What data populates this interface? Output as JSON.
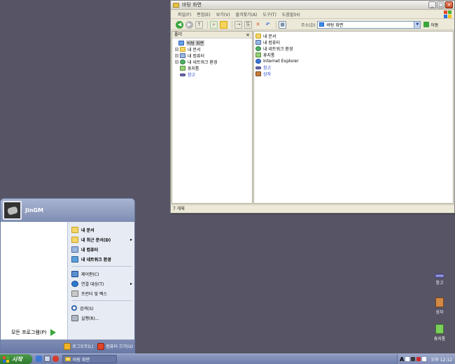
{
  "window": {
    "title": "바탕 화면",
    "menu": [
      "파일(F)",
      "편집(E)",
      "보기(V)",
      "즐겨찾기(A)",
      "도구(T)",
      "도움말(H)"
    ],
    "address_label": "주소(D)",
    "address_value": "바탕 화면",
    "go_label": "이동",
    "folders_title": "폴더",
    "tree": [
      {
        "label": "바탕 화면",
        "icon": "desktop-icon",
        "indent": 0,
        "expander": "",
        "selected": true
      },
      {
        "label": "내 문서",
        "icon": "folder-icon",
        "indent": 1,
        "expander": "+"
      },
      {
        "label": "내 컴퓨터",
        "icon": "computer-icon",
        "indent": 1,
        "expander": "+"
      },
      {
        "label": "내 네트워크 환경",
        "icon": "network-icon",
        "indent": 1,
        "expander": "+"
      },
      {
        "label": "휴지통",
        "icon": "recycle-bin-icon",
        "indent": 1,
        "expander": ""
      },
      {
        "label": "창고",
        "icon": "drive-icon",
        "indent": 1,
        "expander": "",
        "blue": true
      }
    ],
    "items": [
      {
        "label": "내 문서",
        "icon": "folder-icon"
      },
      {
        "label": "내 컴퓨터",
        "icon": "computer-icon"
      },
      {
        "label": "내 네트워크 환경",
        "icon": "network-icon"
      },
      {
        "label": "휴지통",
        "icon": "recycle-bin-icon"
      },
      {
        "label": "Internet Explorer",
        "icon": "internet-explorer-icon"
      },
      {
        "label": "창고",
        "icon": "drive-icon",
        "blue": true
      },
      {
        "label": "상자",
        "icon": "box-icon",
        "blue": true
      }
    ],
    "status": "7 개체"
  },
  "start_menu": {
    "user": "JinGM",
    "all_programs": "모든 프로그램(P)",
    "right_top": [
      {
        "label": "내 문서",
        "icon": "folder-icon",
        "bold": true,
        "submenu": false
      },
      {
        "label": "내 최근 문서(D)",
        "icon": "folder-icon",
        "bold": true,
        "submenu": true
      },
      {
        "label": "내 컴퓨터",
        "icon": "computer-icon",
        "bold": true,
        "submenu": false
      },
      {
        "label": "내 네트워크 환경",
        "icon": "network-icon",
        "bold": true,
        "submenu": false
      }
    ],
    "right_mid": [
      {
        "label": "제어판(C)",
        "icon": "control-panel-icon",
        "submenu": false
      },
      {
        "label": "연결 대상(T)",
        "icon": "connect-icon",
        "submenu": true
      },
      {
        "label": "프린터 및 팩스",
        "icon": "printer-icon",
        "submenu": false
      }
    ],
    "right_bottom": [
      {
        "label": "검색(S)",
        "icon": "search-icon",
        "submenu": false
      },
      {
        "label": "실행(R)...",
        "icon": "run-icon",
        "submenu": false
      }
    ],
    "logoff": "로그오프(L)",
    "shutdown": "컴퓨터 끄기(U)"
  },
  "desktop_icons": [
    {
      "label": "창고",
      "icon": "drive-icon"
    },
    {
      "label": "상자",
      "icon": "box-icon"
    },
    {
      "label": "휴지통",
      "icon": "recycle-bin-icon"
    }
  ],
  "taskbar": {
    "start_label": "시작",
    "task_label": "바탕 화면",
    "clock": "오후 12:12"
  }
}
